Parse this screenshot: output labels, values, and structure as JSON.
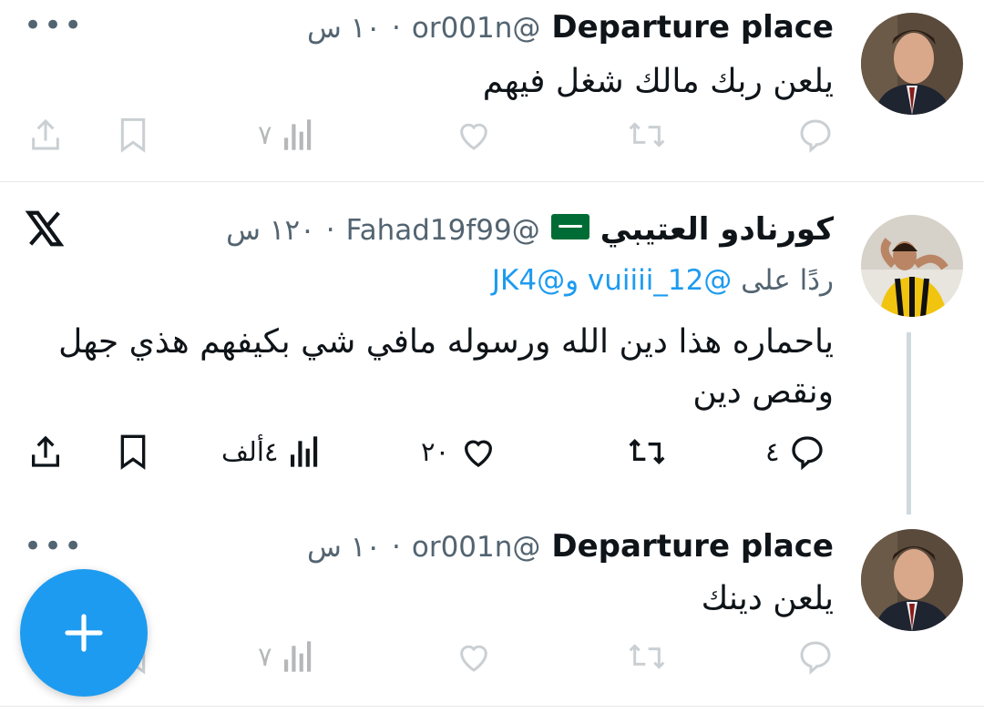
{
  "tweets": [
    {
      "name": "Departure place",
      "handle": "@or001n",
      "time": "١٠ س",
      "text": "يلعن ربك مالك شغل فيهم",
      "views": "٧"
    },
    {
      "name": "كورنادو العتيبي",
      "handle": "@Fahad19f99",
      "time": "١٢٠ س",
      "reply_prefix": "ردًا على",
      "reply_mentions": "@vuiiii_12 و@JK4",
      "text_line1": "ياحماره هذا دين الله ورسوله مافي شي بكيفهم هذي جهل",
      "text_line2": "ونقص دين",
      "replies": "٤",
      "likes": "٢٠",
      "views": "٤ألف"
    },
    {
      "name": "Departure place",
      "handle": "@or001n",
      "time": "١٠ س",
      "text": "يلعن دينك",
      "views": "٧"
    }
  ],
  "colors": {
    "accent": "#1d9bf0",
    "muted": "#536471",
    "text": "#0f1419"
  },
  "icons": [
    "reply-icon",
    "retweet-icon",
    "like-icon",
    "views-icon",
    "bookmark-icon",
    "share-icon",
    "more-icon",
    "x-logo-icon",
    "compose-plus-icon"
  ]
}
